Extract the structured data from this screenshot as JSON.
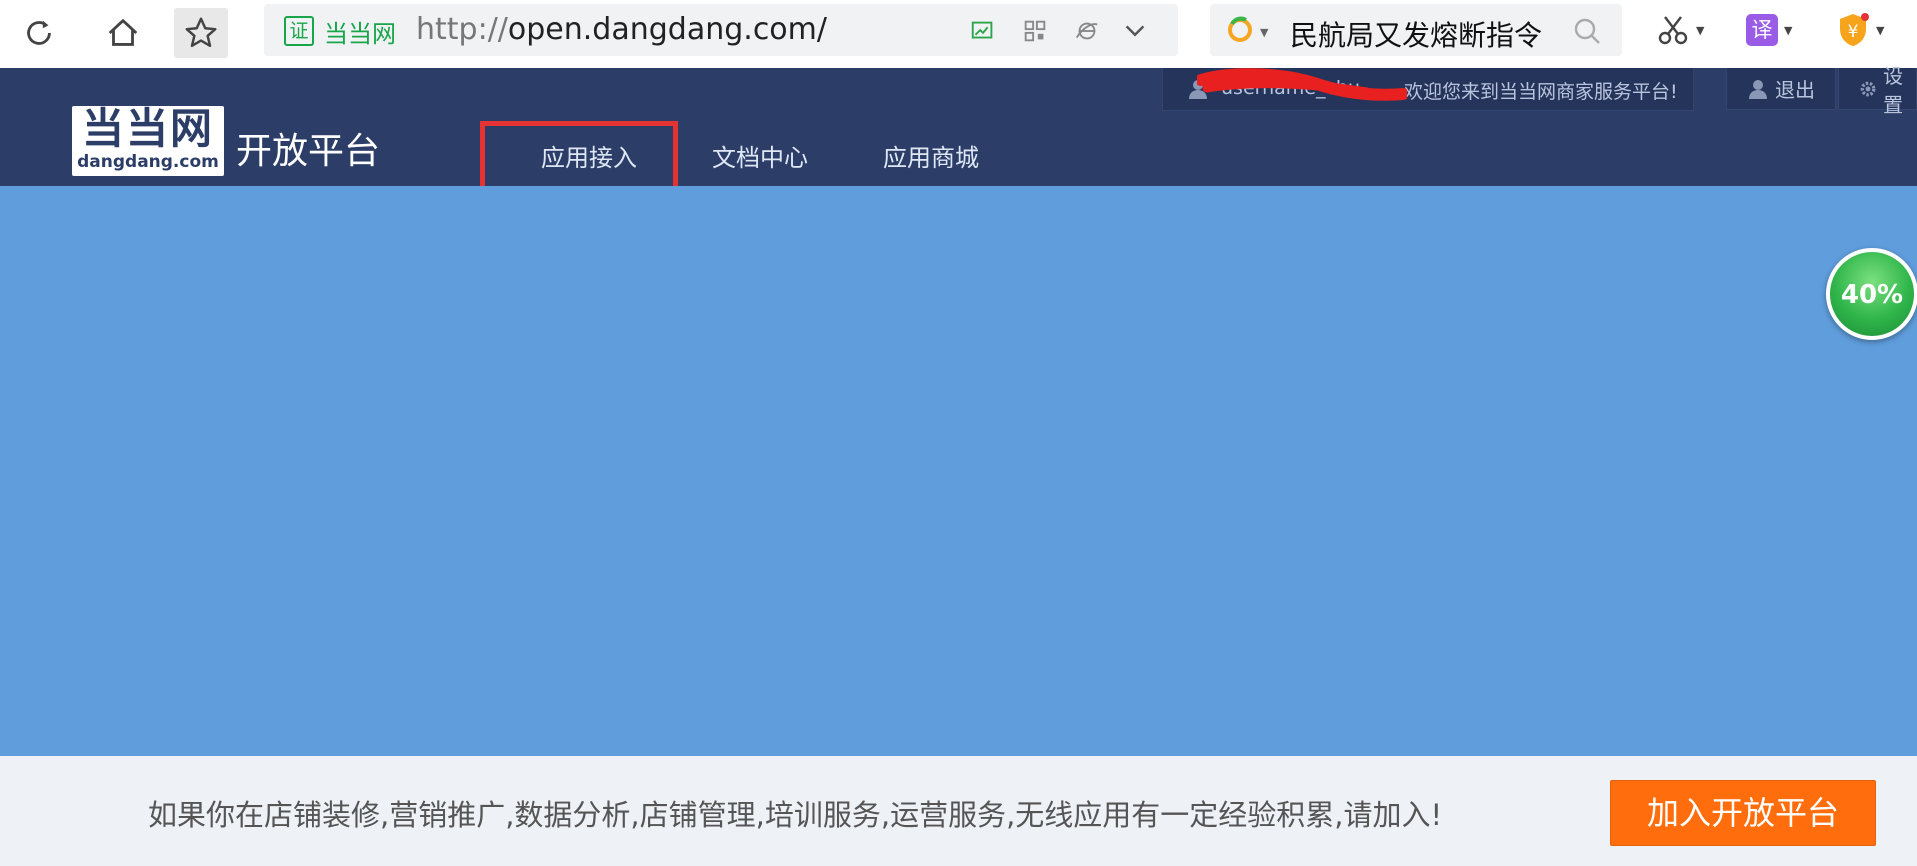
{
  "browser": {
    "url_protocol": "http://",
    "url_host": "open.dangdang.com/",
    "cert_label": "证",
    "site_name": "当当网",
    "search_query": "民航局又发熔断指令",
    "translate_label": "译",
    "wallet_label": "¥"
  },
  "header": {
    "logo_cn": "当当网",
    "logo_en": "dangdang.com",
    "platform_name": "开放平台",
    "nav": [
      "应用接入",
      "文档中心",
      "应用商城"
    ],
    "welcome_user": "username_chu",
    "welcome_text": "，欢迎您来到当当网商家服务平台!",
    "logout_label": "退出",
    "settings_label": "设置"
  },
  "banner": {
    "progress_label": "40%",
    "progress_value": 0.4
  },
  "join": {
    "text": "如果你在店铺装修,营销推广,数据分析,店铺管理,培训服务,运营服务,无线应用有一定经验积累,请加入!",
    "button_label": "加入开放平台"
  },
  "colors": {
    "header_bg": "#2c3e68",
    "banner_bg": "#5f9ddc",
    "join_button": "#ff6d0c",
    "highlight": "#e53232"
  }
}
